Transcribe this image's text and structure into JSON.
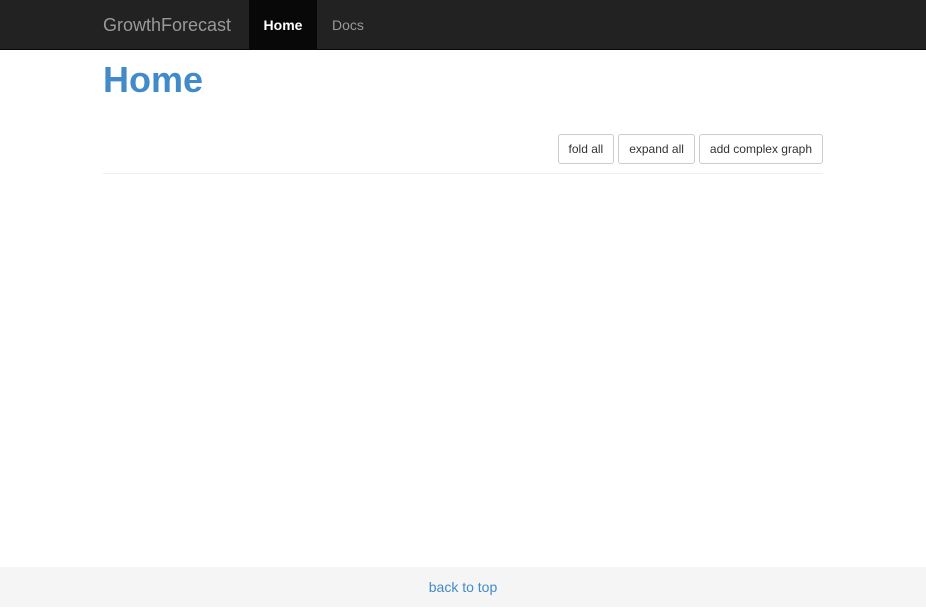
{
  "navbar": {
    "brand": "GrowthForecast",
    "items": [
      {
        "label": "Home",
        "active": true
      },
      {
        "label": "Docs",
        "active": false
      }
    ]
  },
  "page": {
    "title": "Home"
  },
  "toolbar": {
    "fold_all_label": "fold all",
    "expand_all_label": "expand all",
    "add_complex_graph_label": "add complex graph"
  },
  "footer": {
    "back_to_top_label": "back to top"
  },
  "colors": {
    "navbar_bg": "#222222",
    "active_nav_bg": "#080808",
    "accent": "#428bca",
    "footer_bg": "#f5f5f5"
  }
}
